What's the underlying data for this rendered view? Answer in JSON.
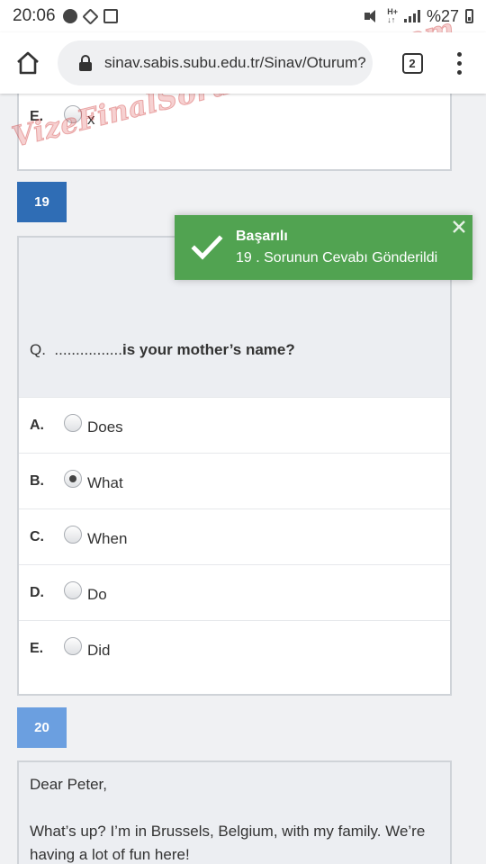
{
  "status_bar": {
    "time": "20:06",
    "battery": "%27"
  },
  "browser": {
    "url": "sinav.sabis.subu.edu.tr/Sinav/Oturum?",
    "tab_count": "2"
  },
  "watermark": "VizeFinalSoruPaylasimi.com",
  "prev_question": {
    "option_letter": "E.",
    "option_text": "x"
  },
  "question_19": {
    "number": "19",
    "number_color": "#2f6db5",
    "prefix": "Q.",
    "dots": "................",
    "stem": "is your mother’s name?",
    "options": [
      {
        "letter": "A.",
        "text": "Does",
        "selected": false
      },
      {
        "letter": "B.",
        "text": "What",
        "selected": true
      },
      {
        "letter": "C.",
        "text": "When",
        "selected": false
      },
      {
        "letter": "D.",
        "text": "Do",
        "selected": false
      },
      {
        "letter": "E.",
        "text": "Did",
        "selected": false
      }
    ]
  },
  "question_20": {
    "number": "20",
    "number_color": "#6b9fe0",
    "greeting": "Dear Peter,",
    "body": "What’s up?  I’m in Brussels, Belgium, with my family. We’re having a lot of fun here!"
  },
  "toast": {
    "title": "Başarılı",
    "message": "19 . Sorunun Cevabı Gönderildi",
    "color": "#51a351"
  }
}
